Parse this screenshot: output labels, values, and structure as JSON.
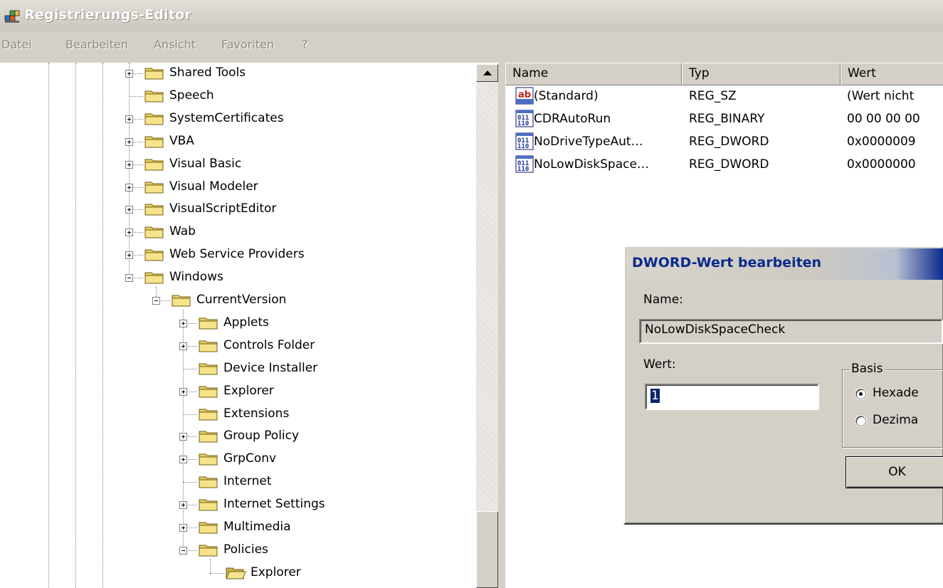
{
  "window": {
    "title": "Registrierungs-Editor",
    "icon": "registry-editor-icon"
  },
  "menu": {
    "items": [
      "Datei",
      "Bearbeiten",
      "Ansicht",
      "Favoriten",
      "?"
    ]
  },
  "tree": {
    "items": [
      {
        "label": "Shared Tools",
        "expander": "plus"
      },
      {
        "label": "Speech",
        "expander": "none"
      },
      {
        "label": "SystemCertificates",
        "expander": "plus"
      },
      {
        "label": "VBA",
        "expander": "plus"
      },
      {
        "label": "Visual Basic",
        "expander": "plus"
      },
      {
        "label": "Visual Modeler",
        "expander": "plus"
      },
      {
        "label": "VisualScriptEditor",
        "expander": "plus"
      },
      {
        "label": "Wab",
        "expander": "plus"
      },
      {
        "label": "Web Service Providers",
        "expander": "plus"
      },
      {
        "label": "Windows",
        "expander": "minus"
      },
      {
        "label": "CurrentVersion",
        "expander": "minus"
      },
      {
        "label": "Applets",
        "expander": "plus"
      },
      {
        "label": "Controls Folder",
        "expander": "plus"
      },
      {
        "label": "Device Installer",
        "expander": "none"
      },
      {
        "label": "Explorer",
        "expander": "plus"
      },
      {
        "label": "Extensions",
        "expander": "none"
      },
      {
        "label": "Group Policy",
        "expander": "plus"
      },
      {
        "label": "GrpConv",
        "expander": "plus"
      },
      {
        "label": "Internet",
        "expander": "none"
      },
      {
        "label": "Internet Settings",
        "expander": "plus"
      },
      {
        "label": "Multimedia",
        "expander": "plus"
      },
      {
        "label": "Policies",
        "expander": "minus"
      },
      {
        "label": "Explorer",
        "expander": "none",
        "selected_open": true
      }
    ]
  },
  "list": {
    "columns": [
      "Name",
      "Typ",
      "Wert"
    ],
    "rows": [
      {
        "icon": "string-value-icon",
        "name": "(Standard)",
        "type": "REG_SZ",
        "value": "(Wert nicht"
      },
      {
        "icon": "binary-value-icon",
        "name": "CDRAutoRun",
        "type": "REG_BINARY",
        "value": "00 00 00 00"
      },
      {
        "icon": "binary-value-icon",
        "name": "NoDriveTypeAut…",
        "type": "REG_DWORD",
        "value": "0x0000009"
      },
      {
        "icon": "binary-value-icon",
        "name": "NoLowDiskSpace…",
        "type": "REG_DWORD",
        "value": "0x0000000"
      }
    ]
  },
  "dialog": {
    "title": "DWORD-Wert bearbeiten",
    "name_label": "Name:",
    "name_value": "NoLowDiskSpaceCheck",
    "value_label": "Wert:",
    "value_value": "1",
    "basis_label": "Basis",
    "radio_hex": "Hexade",
    "radio_dec": "Dezima",
    "ok_label": "OK"
  },
  "colors": {
    "selection": "#0a246a",
    "title_accent": "#0a2a8e",
    "face": "#d4d0c8"
  }
}
